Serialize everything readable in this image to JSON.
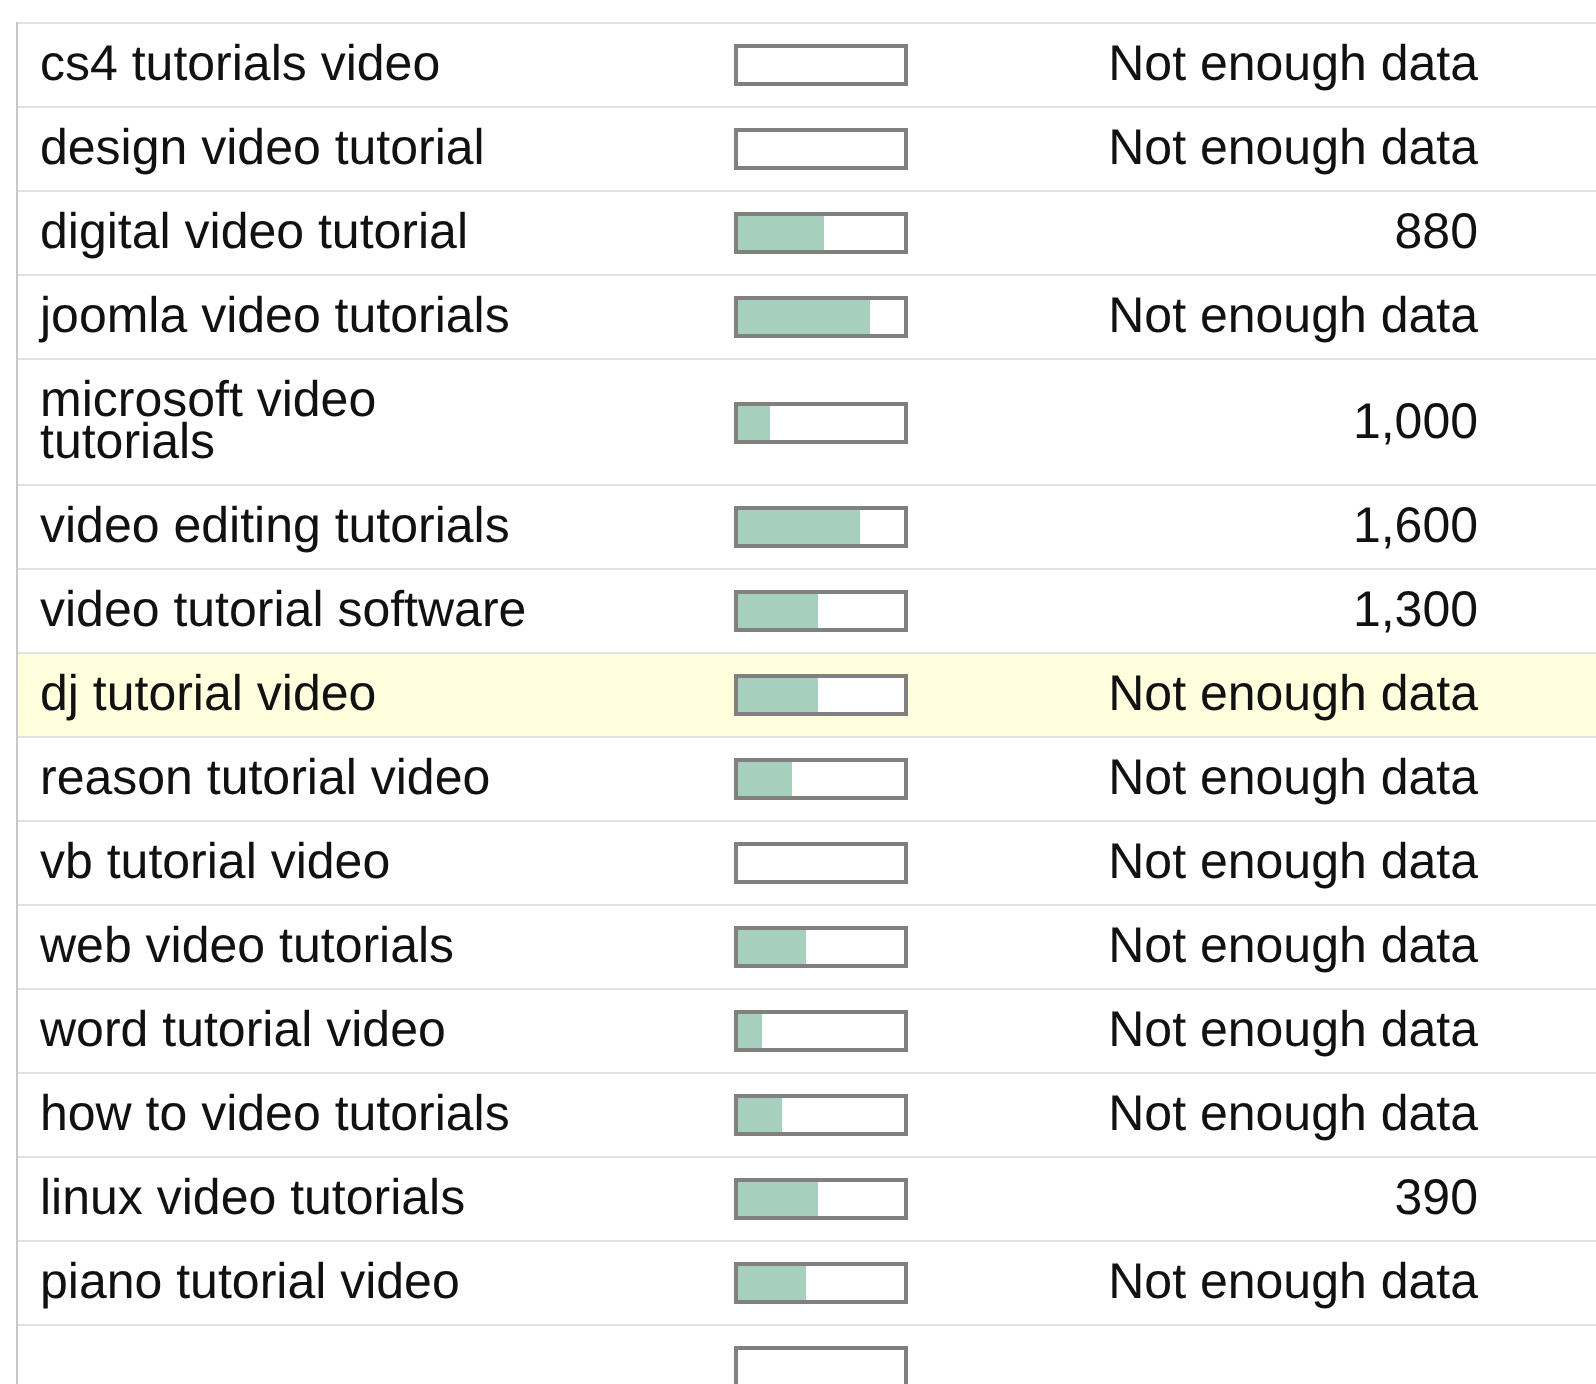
{
  "rows": [
    {
      "keyword": "cs4 tutorials video",
      "level": 0,
      "value": "Not enough data",
      "selected": false
    },
    {
      "keyword": "design video tutorial",
      "level": 0,
      "value": "Not enough data",
      "selected": false
    },
    {
      "keyword": "digital video tutorial",
      "level": 0.52,
      "value": "880",
      "selected": false
    },
    {
      "keyword": "joomla video tutorials",
      "level": 0.8,
      "value": "Not enough data",
      "selected": false
    },
    {
      "keyword": "microsoft video tutorials",
      "level": 0.19,
      "value": "1,000",
      "selected": false
    },
    {
      "keyword": "video editing tutorials",
      "level": 0.73,
      "value": "1,600",
      "selected": false
    },
    {
      "keyword": "video tutorial software",
      "level": 0.48,
      "value": "1,300",
      "selected": false
    },
    {
      "keyword": "dj tutorial video",
      "level": 0.48,
      "value": "Not enough data",
      "selected": true
    },
    {
      "keyword": "reason tutorial video",
      "level": 0.33,
      "value": "Not enough data",
      "selected": false
    },
    {
      "keyword": "vb tutorial video",
      "level": 0,
      "value": "Not enough data",
      "selected": false
    },
    {
      "keyword": "web video tutorials",
      "level": 0.41,
      "value": "Not enough data",
      "selected": false
    },
    {
      "keyword": "word tutorial video",
      "level": 0.15,
      "value": "Not enough data",
      "selected": false
    },
    {
      "keyword": "how to video tutorials",
      "level": 0.26,
      "value": "Not enough data",
      "selected": false
    },
    {
      "keyword": "linux video tutorials",
      "level": 0.48,
      "value": "390",
      "selected": false
    },
    {
      "keyword": "piano tutorial video",
      "level": 0.41,
      "value": "Not enough data",
      "selected": false
    },
    {
      "level": 0,
      "selected": false
    }
  ]
}
